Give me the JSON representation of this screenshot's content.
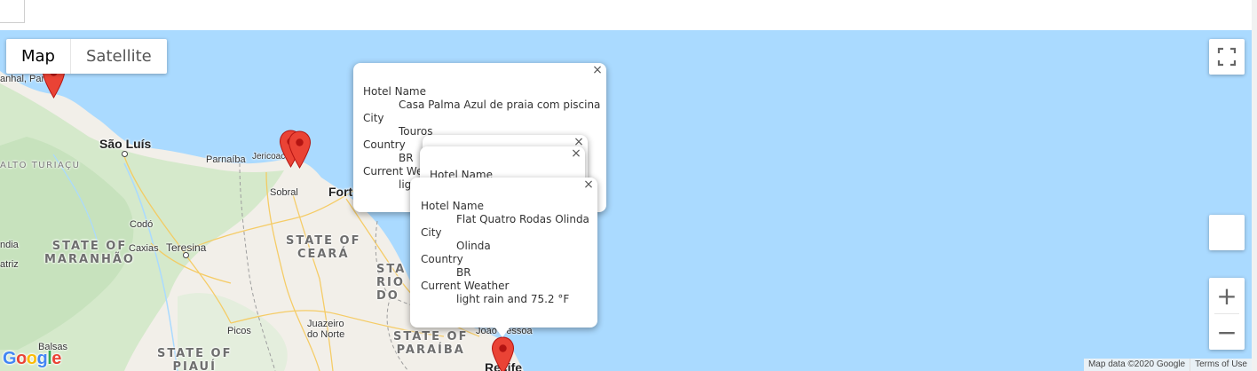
{
  "map_type": {
    "map_label": "Map",
    "satellite_label": "Satellite",
    "selected": "Map"
  },
  "places": {
    "cities": {
      "sao_luis": "São Luís",
      "teresina": "Teresina",
      "fortaleza": "Fort",
      "sobral": "Sobral",
      "parnaiba": "Parnaíba",
      "jericoacoara": "Jericoaco",
      "codo": "Codó",
      "caxias": "Caxias",
      "juazeiro": "Juazeiro\ndo Norte",
      "picos": "Picos",
      "balsas": "Balsas",
      "joao_pessoa": "João Pessoa",
      "recife": "Recife",
      "castanhal": "anhal, Pará",
      "atriz": "atriz",
      "india": "ndia"
    },
    "states": {
      "maranhao": "STATE OF\nMARANHÃO",
      "ceara": "STATE OF\nCEARÁ",
      "rio_grande": "STA\nRIO G\nDO",
      "paraiba": "STATE OF\nPARAÍBA",
      "piaui": "STATE OF\nPIAUÍ",
      "alto_turiacu": "ALTO TURIAÇU"
    }
  },
  "info_windows": [
    {
      "fields": [
        {
          "label": "Hotel Name",
          "value": "Casa Palma Azul de praia com piscina"
        },
        {
          "label": "City",
          "value": "Touros"
        },
        {
          "label": "Country",
          "value": "BR"
        },
        {
          "label": "Current Weather",
          "value": "light rain"
        }
      ],
      "visible_value_3": "lig",
      "visible_label_3": "Current We"
    },
    {
      "fields": [
        {
          "label": "Hotel Name",
          "value": ""
        }
      ]
    },
    {
      "fields": [
        {
          "label": "Hotel Name",
          "value": "Flat Quatro Rodas Olinda"
        },
        {
          "label": "City",
          "value": "Olinda"
        },
        {
          "label": "Country",
          "value": "BR"
        },
        {
          "label": "Current Weather",
          "value": "light rain and 75.2 °F"
        }
      ]
    }
  ],
  "close_symbol": "×",
  "zoom": {
    "in": "+",
    "out": "−"
  },
  "attribution": {
    "map_data": "Map data ©2020 Google",
    "terms": "Terms of Use"
  },
  "logo": "Google",
  "colors": {
    "water": "#aadaff",
    "land": "#f2efe9",
    "forest": "#cde6c4",
    "marker": "#ea4335",
    "road": "#f8d36b"
  },
  "icons": {
    "fullscreen": "fullscreen-icon",
    "pegman": "pegman-icon",
    "marker": "map-marker-icon"
  }
}
